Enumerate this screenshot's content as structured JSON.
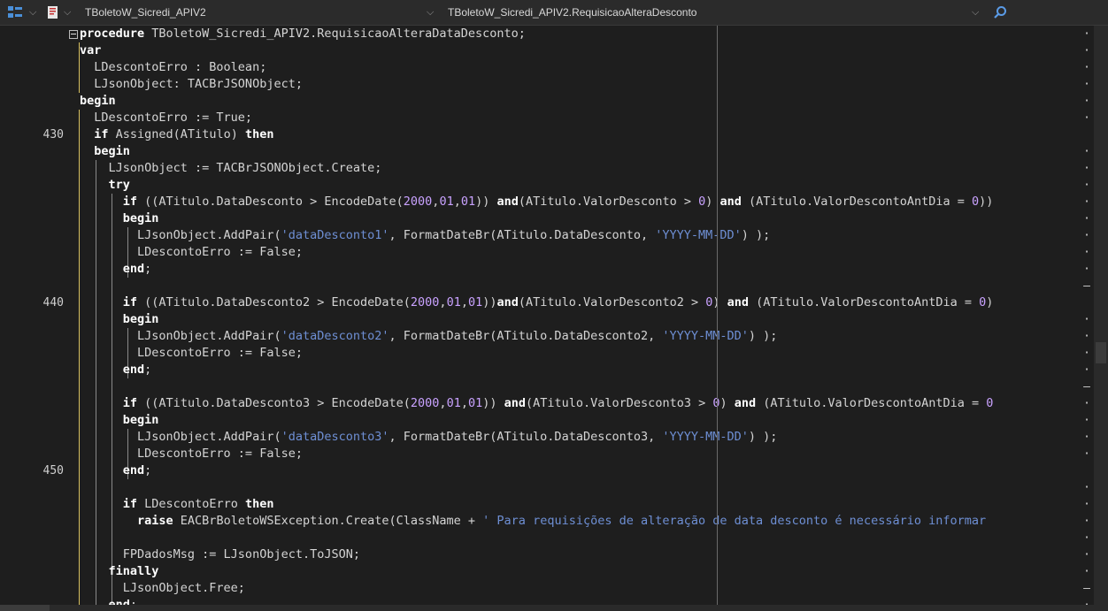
{
  "toolbar": {
    "unit_name": "TBoletoW_Sicredi_APIV2",
    "method_name": "TBoletoW_Sicredi_APIV2.RequisicaoAlteraDesconto"
  },
  "gutter": {
    "ln_430": "430",
    "ln_440": "440",
    "ln_450": "450",
    "dot": "·"
  },
  "lines": [
    {
      "segments": [
        {
          "t": "procedure",
          "c": "kw"
        },
        {
          "t": " TBoletoW_Sicredi_APIV2.RequisicaoAlteraDataDesconto;"
        }
      ]
    },
    {
      "segments": [
        {
          "t": "var",
          "c": "kw"
        }
      ]
    },
    {
      "segments": [
        {
          "t": "  LDescontoErro : Boolean;"
        }
      ]
    },
    {
      "segments": [
        {
          "t": "  LJsonObject: TACBrJSONObject;"
        }
      ]
    },
    {
      "segments": [
        {
          "t": "begin",
          "c": "kw"
        }
      ]
    },
    {
      "segments": [
        {
          "t": "  LDescontoErro := True;"
        }
      ]
    },
    {
      "segments": [
        {
          "t": "  "
        },
        {
          "t": "if",
          "c": "kw"
        },
        {
          "t": " Assigned(ATitulo) "
        },
        {
          "t": "then",
          "c": "kw"
        }
      ]
    },
    {
      "segments": [
        {
          "t": "  "
        },
        {
          "t": "begin",
          "c": "kw"
        }
      ]
    },
    {
      "segments": [
        {
          "t": "    LJsonObject := TACBrJSONObject.Create;"
        }
      ]
    },
    {
      "segments": [
        {
          "t": "    "
        },
        {
          "t": "try",
          "c": "kw"
        }
      ]
    },
    {
      "segments": [
        {
          "t": "      "
        },
        {
          "t": "if",
          "c": "kw"
        },
        {
          "t": " ((ATitulo.DataDesconto > EncodeDate("
        },
        {
          "t": "2000",
          "c": "num"
        },
        {
          "t": ","
        },
        {
          "t": "01",
          "c": "num"
        },
        {
          "t": ","
        },
        {
          "t": "01",
          "c": "num"
        },
        {
          "t": ")) "
        },
        {
          "t": "and",
          "c": "kw"
        },
        {
          "t": "(ATitulo.ValorDesconto > "
        },
        {
          "t": "0",
          "c": "num"
        },
        {
          "t": ") "
        },
        {
          "t": "and",
          "c": "kw"
        },
        {
          "t": " (ATitulo.ValorDescontoAntDia = "
        },
        {
          "t": "0",
          "c": "num"
        },
        {
          "t": "))"
        }
      ]
    },
    {
      "segments": [
        {
          "t": "      "
        },
        {
          "t": "begin",
          "c": "kw"
        }
      ]
    },
    {
      "segments": [
        {
          "t": "        LJsonObject.AddPair("
        },
        {
          "t": "'dataDesconto1'",
          "c": "str"
        },
        {
          "t": ", FormatDateBr(ATitulo.DataDesconto, "
        },
        {
          "t": "'YYYY-MM-DD'",
          "c": "str"
        },
        {
          "t": ") );"
        }
      ]
    },
    {
      "segments": [
        {
          "t": "        LDescontoErro := False;"
        }
      ]
    },
    {
      "segments": [
        {
          "t": "      "
        },
        {
          "t": "end",
          "c": "kw"
        },
        {
          "t": ";"
        }
      ]
    },
    {
      "segments": [
        {
          "t": ""
        }
      ]
    },
    {
      "segments": [
        {
          "t": "      "
        },
        {
          "t": "if",
          "c": "kw"
        },
        {
          "t": " ((ATitulo.DataDesconto2 > EncodeDate("
        },
        {
          "t": "2000",
          "c": "num"
        },
        {
          "t": ","
        },
        {
          "t": "01",
          "c": "num"
        },
        {
          "t": ","
        },
        {
          "t": "01",
          "c": "num"
        },
        {
          "t": "))"
        },
        {
          "t": "and",
          "c": "kw"
        },
        {
          "t": "(ATitulo.ValorDesconto2 > "
        },
        {
          "t": "0",
          "c": "num"
        },
        {
          "t": ") "
        },
        {
          "t": "and",
          "c": "kw"
        },
        {
          "t": " (ATitulo.ValorDescontoAntDia = "
        },
        {
          "t": "0",
          "c": "num"
        },
        {
          "t": ")"
        }
      ]
    },
    {
      "segments": [
        {
          "t": "      "
        },
        {
          "t": "begin",
          "c": "kw"
        }
      ]
    },
    {
      "segments": [
        {
          "t": "        LJsonObject.AddPair("
        },
        {
          "t": "'dataDesconto2'",
          "c": "str"
        },
        {
          "t": ", FormatDateBr(ATitulo.DataDesconto2, "
        },
        {
          "t": "'YYYY-MM-DD'",
          "c": "str"
        },
        {
          "t": ") );"
        }
      ]
    },
    {
      "segments": [
        {
          "t": "        LDescontoErro := False;"
        }
      ]
    },
    {
      "segments": [
        {
          "t": "      "
        },
        {
          "t": "end",
          "c": "kw"
        },
        {
          "t": ";"
        }
      ]
    },
    {
      "segments": [
        {
          "t": ""
        }
      ]
    },
    {
      "segments": [
        {
          "t": "      "
        },
        {
          "t": "if",
          "c": "kw"
        },
        {
          "t": " ((ATitulo.DataDesconto3 > EncodeDate("
        },
        {
          "t": "2000",
          "c": "num"
        },
        {
          "t": ","
        },
        {
          "t": "01",
          "c": "num"
        },
        {
          "t": ","
        },
        {
          "t": "01",
          "c": "num"
        },
        {
          "t": ")) "
        },
        {
          "t": "and",
          "c": "kw"
        },
        {
          "t": "(ATitulo.ValorDesconto3 > "
        },
        {
          "t": "0",
          "c": "num"
        },
        {
          "t": ") "
        },
        {
          "t": "and",
          "c": "kw"
        },
        {
          "t": " (ATitulo.ValorDescontoAntDia = "
        },
        {
          "t": "0",
          "c": "num"
        }
      ]
    },
    {
      "segments": [
        {
          "t": "      "
        },
        {
          "t": "begin",
          "c": "kw"
        }
      ]
    },
    {
      "segments": [
        {
          "t": "        LJsonObject.AddPair("
        },
        {
          "t": "'dataDesconto3'",
          "c": "str"
        },
        {
          "t": ", FormatDateBr(ATitulo.DataDesconto3, "
        },
        {
          "t": "'YYYY-MM-DD'",
          "c": "str"
        },
        {
          "t": ") );"
        }
      ]
    },
    {
      "segments": [
        {
          "t": "        LDescontoErro := False;"
        }
      ]
    },
    {
      "segments": [
        {
          "t": "      "
        },
        {
          "t": "end",
          "c": "kw"
        },
        {
          "t": ";"
        }
      ]
    },
    {
      "segments": [
        {
          "t": ""
        }
      ]
    },
    {
      "segments": [
        {
          "t": "      "
        },
        {
          "t": "if",
          "c": "kw"
        },
        {
          "t": " LDescontoErro "
        },
        {
          "t": "then",
          "c": "kw"
        }
      ]
    },
    {
      "segments": [
        {
          "t": "        "
        },
        {
          "t": "raise",
          "c": "kw"
        },
        {
          "t": " EACBrBoletoWSException.Create(ClassName + "
        },
        {
          "t": "' Para requisições de alteração de data desconto é necessário informar ",
          "c": "str"
        }
      ]
    },
    {
      "segments": [
        {
          "t": ""
        }
      ]
    },
    {
      "segments": [
        {
          "t": "      FPDadosMsg := LJsonObject.ToJSON;"
        }
      ]
    },
    {
      "segments": [
        {
          "t": "    "
        },
        {
          "t": "finally",
          "c": "kw"
        }
      ]
    },
    {
      "segments": [
        {
          "t": "      LJsonObject.Free;"
        }
      ]
    },
    {
      "segments": [
        {
          "t": "    "
        },
        {
          "t": "end",
          "c": "kw"
        },
        {
          "t": ";"
        }
      ]
    }
  ]
}
